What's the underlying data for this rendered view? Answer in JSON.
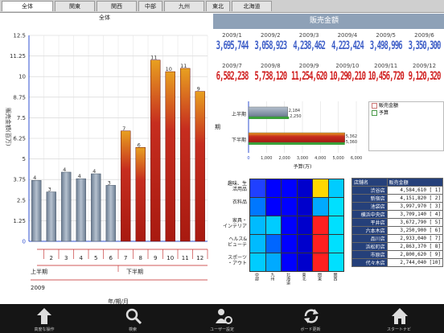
{
  "tabs": [
    "全体",
    "関東",
    "関西",
    "中部",
    "九州",
    "東北",
    "北海道"
  ],
  "chart_title": "全体",
  "chart_data": {
    "type": "bar",
    "categories": [
      "1",
      "2",
      "3",
      "4",
      "5",
      "6",
      "7",
      "8",
      "9",
      "10",
      "11",
      "12"
    ],
    "values": [
      3.7,
      3.0,
      4.2,
      3.8,
      4.1,
      3.4,
      6.7,
      5.7,
      11.0,
      10.3,
      10.5,
      9.1
    ],
    "value_labels": [
      "4",
      "3",
      "4",
      "4",
      "4",
      "3",
      "7",
      "6",
      "11",
      "10",
      "11",
      "9"
    ],
    "ylabel": "販売金額(百万)",
    "xlabel": "年/期/月",
    "ylim": [
      0,
      12.5
    ],
    "yticks": [
      "0",
      "1.25",
      "2.5",
      "3.75",
      "5",
      "6.25",
      "7.5",
      "8.75",
      "10",
      "11.25",
      "12.5"
    ],
    "period_labels": [
      "上半期",
      "下半期"
    ],
    "year_label": "2009",
    "colors": {
      "first_half": "#8a99ab",
      "second_half": "#c62d1f",
      "second_half_top": "#e8a020"
    }
  },
  "sales": {
    "header": "販売金額",
    "months": [
      "2009/1",
      "2009/2",
      "2009/3",
      "2009/4",
      "2009/5",
      "2009/6",
      "2009/7",
      "2009/8",
      "2009/9",
      "2009/10",
      "2009/11",
      "2009/12"
    ],
    "values": [
      "3,695,744",
      "3,058,923",
      "4,238,462",
      "4,223,424",
      "3,498,996",
      "3,350,300",
      "6,582,238",
      "5,738,120",
      "11,254,620",
      "10,290,210",
      "10,456,720",
      "9,120,320"
    ]
  },
  "half_chart": {
    "rows": [
      "上半期",
      "下半期"
    ],
    "axis_title": "期",
    "xlabel": "予算(万)",
    "xticks": [
      "0",
      "1,000",
      "2,000",
      "3,000",
      "4,000",
      "5,000",
      "6,000"
    ],
    "sales": [
      2184,
      5362
    ],
    "budget": [
      2250,
      5360
    ],
    "sales_labels": [
      "2,184",
      "5,362"
    ],
    "budget_labels": [
      "2,250",
      "5,360"
    ]
  },
  "legend": {
    "sales": "販売金額",
    "budget": "予算"
  },
  "heatmap": {
    "rows": [
      "趣味、生\n活用品",
      "衣料品",
      "家具・\nインテリア",
      "ヘルス&\nビューテ",
      "スポーツ\n・アウト"
    ],
    "cols": [
      "中部",
      "九州",
      "北海道",
      "東北",
      "関東",
      "関西"
    ],
    "colors": [
      [
        "#2040ff",
        "#0000ff",
        "#0000ff",
        "#0000cc",
        "#ffd700",
        "#00ccff"
      ],
      [
        "#0077ff",
        "#0000ff",
        "#0000ff",
        "#0000cc",
        "#00aaff",
        "#00e0ff"
      ],
      [
        "#00bbff",
        "#00ccff",
        "#0000ff",
        "#0000cc",
        "#ff2020",
        "#00e0ff"
      ],
      [
        "#00bbff",
        "#0066ff",
        "#0000ff",
        "#0000cc",
        "#ff2020",
        "#00e0ff"
      ],
      [
        "#00ccff",
        "#00aaff",
        "#0000ff",
        "#0000cc",
        "#ff2020",
        "#00e0ff"
      ]
    ]
  },
  "shops": {
    "headers": [
      "店舗名",
      "販売金額"
    ],
    "rows": [
      [
        "渋谷店",
        "4,584,610 [ 1]"
      ],
      [
        "新宿店",
        "4,151,820 [ 2]"
      ],
      [
        "池袋店",
        "3,997,970 [ 3]"
      ],
      [
        "横浜中央店",
        "3,709,140 [ 4]"
      ],
      [
        "平井店",
        "3,672,790 [ 5]"
      ],
      [
        "六本木店",
        "3,250,900 [ 6]"
      ],
      [
        "品川店",
        "2,933,040 [ 7]"
      ],
      [
        "浜松町店",
        "2,863,370 [ 8]"
      ],
      [
        "市原店",
        "2,800,620 [ 9]"
      ],
      [
        "代々木店",
        "2,744,040 [10]"
      ]
    ]
  },
  "bottom_bar": [
    "高度な操作",
    "検索",
    "ユーザー設定",
    "ボード更新",
    "スタートナビ"
  ]
}
